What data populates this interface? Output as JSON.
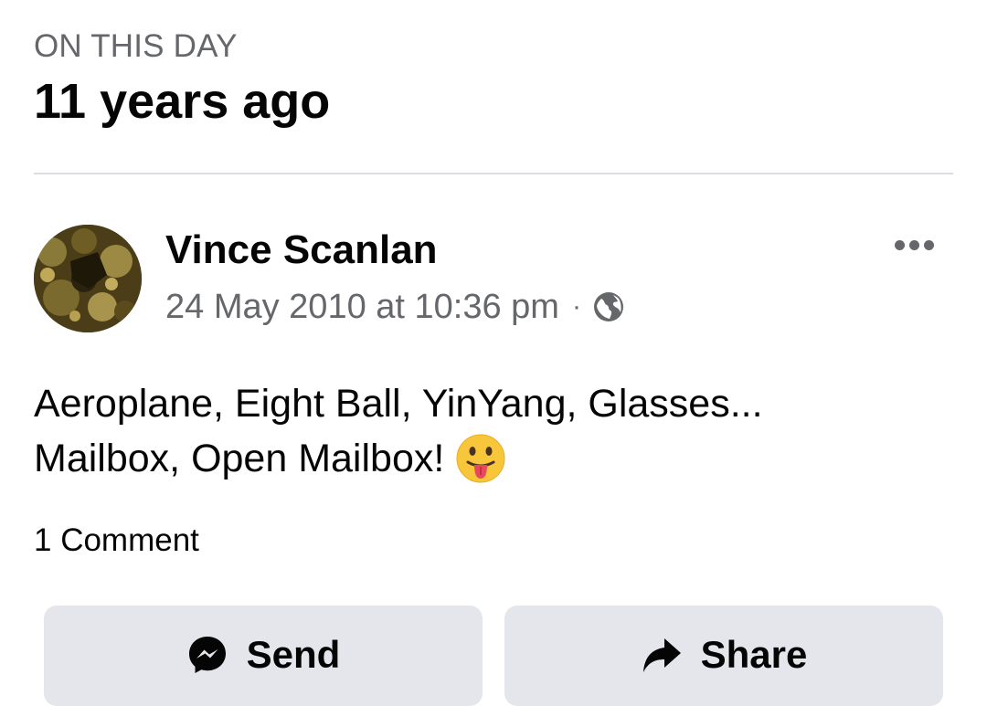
{
  "memory": {
    "label": "ON THIS DAY",
    "title": "11 years ago"
  },
  "post": {
    "author": "Vince Scanlan",
    "timestamp": "24 May 2010 at 10:36 pm",
    "separator": "·",
    "privacy_icon": "globe-icon",
    "menu_icon": "more-options-icon",
    "text_line_1": "Aeroplane, Eight Ball, YinYang, Glasses...",
    "text_line_2": "Mailbox, Open Mailbox!",
    "emoji": "tongue-out-emoji",
    "comments_count": "1 Comment"
  },
  "actions": {
    "send_label": "Send",
    "send_icon": "messenger-icon",
    "share_label": "Share",
    "share_icon": "share-arrow-icon"
  },
  "colors": {
    "secondary_text": "#65676b",
    "primary_text": "#050505",
    "button_bg": "#e4e6eb",
    "divider": "#dadde1"
  }
}
